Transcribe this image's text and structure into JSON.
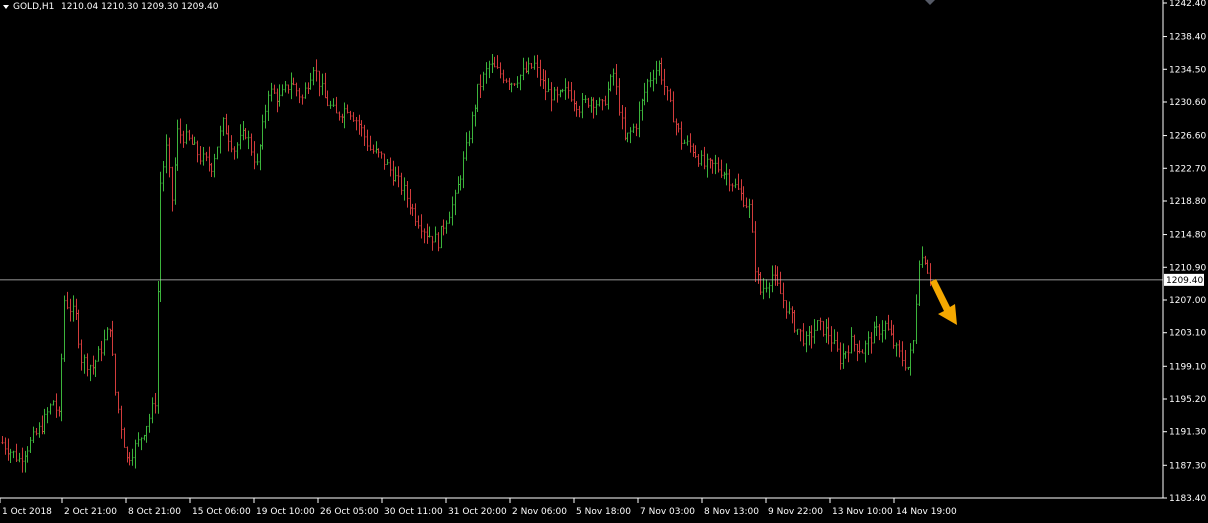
{
  "header": {
    "symbol": "GOLD,H1",
    "ohlc": "1210.04 1210.30 1209.30 1209.40"
  },
  "colors": {
    "background": "#000000",
    "bull": "#3cb43c",
    "bear": "#d23c3c",
    "axis": "#ffffff",
    "price_line": "#c8c8c8",
    "arrow": "#f5a800"
  },
  "chart_data": {
    "type": "bar",
    "style": "ohlc-bars",
    "current_price": "1209.40",
    "y_ticks": [
      "1242.40",
      "1238.40",
      "1234.50",
      "1230.60",
      "1226.60",
      "1222.70",
      "1218.80",
      "1214.80",
      "1210.90",
      "1207.00",
      "1203.10",
      "1199.10",
      "1195.20",
      "1191.30",
      "1187.30",
      "1183.40"
    ],
    "x_ticks": [
      "1 Oct 2018",
      "2 Oct 21:00",
      "8 Oct 21:00",
      "15 Oct 06:00",
      "19 Oct 10:00",
      "26 Oct 05:00",
      "30 Oct 11:00",
      "31 Oct 20:00",
      "2 Nov 06:00",
      "5 Nov 18:00",
      "7 Nov 03:00",
      "8 Nov 13:00",
      "9 Nov 22:00",
      "13 Nov 10:00",
      "14 Nov 19:00"
    ],
    "ylim": [
      1183.4,
      1242.4
    ],
    "price_path_keypoints": [
      [
        0,
        1190
      ],
      [
        6,
        1188
      ],
      [
        14,
        1192
      ],
      [
        18,
        1195
      ],
      [
        20,
        1193
      ],
      [
        22,
        1207
      ],
      [
        26,
        1205
      ],
      [
        28,
        1200
      ],
      [
        32,
        1199
      ],
      [
        36,
        1202
      ],
      [
        38,
        1204
      ],
      [
        40,
        1196
      ],
      [
        44,
        1188
      ],
      [
        48,
        1190
      ],
      [
        52,
        1193
      ],
      [
        54,
        1195
      ],
      [
        56,
        1221
      ],
      [
        58,
        1225
      ],
      [
        60,
        1219
      ],
      [
        62,
        1227
      ],
      [
        66,
        1226
      ],
      [
        70,
        1224
      ],
      [
        74,
        1223
      ],
      [
        78,
        1228
      ],
      [
        82,
        1225
      ],
      [
        86,
        1227
      ],
      [
        90,
        1223
      ],
      [
        94,
        1232
      ],
      [
        98,
        1231
      ],
      [
        102,
        1233
      ],
      [
        106,
        1231
      ],
      [
        110,
        1235
      ],
      [
        114,
        1231
      ],
      [
        118,
        1229
      ],
      [
        122,
        1230
      ],
      [
        126,
        1228
      ],
      [
        130,
        1225
      ],
      [
        134,
        1224
      ],
      [
        138,
        1222
      ],
      [
        142,
        1220
      ],
      [
        146,
        1217
      ],
      [
        150,
        1215
      ],
      [
        154,
        1214
      ],
      [
        156,
        1216
      ],
      [
        160,
        1219
      ],
      [
        164,
        1225
      ],
      [
        168,
        1232
      ],
      [
        172,
        1235
      ],
      [
        176,
        1234
      ],
      [
        180,
        1233
      ],
      [
        184,
        1234
      ],
      [
        188,
        1235
      ],
      [
        192,
        1232
      ],
      [
        196,
        1231
      ],
      [
        200,
        1232
      ],
      [
        204,
        1230
      ],
      [
        208,
        1231
      ],
      [
        212,
        1230
      ],
      [
        216,
        1234
      ],
      [
        220,
        1226
      ],
      [
        224,
        1228
      ],
      [
        228,
        1233
      ],
      [
        232,
        1235
      ],
      [
        236,
        1230
      ],
      [
        240,
        1226
      ],
      [
        244,
        1225
      ],
      [
        248,
        1223
      ],
      [
        252,
        1223
      ],
      [
        256,
        1222
      ],
      [
        260,
        1220
      ],
      [
        264,
        1218
      ],
      [
        266,
        1211
      ],
      [
        268,
        1208
      ],
      [
        272,
        1210
      ],
      [
        276,
        1207
      ],
      [
        280,
        1204
      ],
      [
        284,
        1202
      ],
      [
        288,
        1204
      ],
      [
        292,
        1203
      ],
      [
        296,
        1200
      ],
      [
        300,
        1202
      ],
      [
        304,
        1201
      ],
      [
        308,
        1203
      ],
      [
        312,
        1204
      ],
      [
        316,
        1201
      ],
      [
        320,
        1199
      ],
      [
        322,
        1202
      ],
      [
        324,
        1212
      ],
      [
        326,
        1212
      ],
      [
        328,
        1209.4
      ]
    ]
  },
  "annotation": {
    "arrow": "down-right-arrow"
  }
}
